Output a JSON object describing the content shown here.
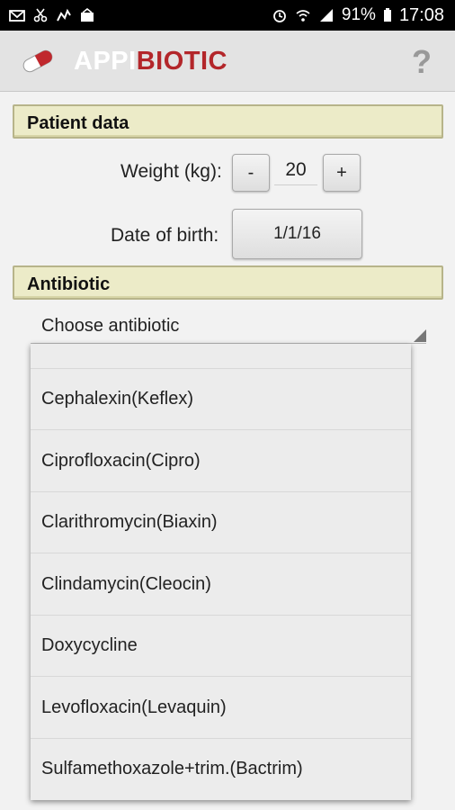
{
  "status_bar": {
    "left_icons": [
      "email-icon",
      "scissors-icon",
      "run-icon",
      "inbox-icon"
    ],
    "alarm_icon": "alarm-icon",
    "wifi_icon": "wifi-icon",
    "signal_icon": "signal-icon",
    "battery_percent": "91%",
    "battery_icon": "battery-icon",
    "time": "17:08"
  },
  "app_bar": {
    "logo_icon": "pill-icon",
    "title_part1": "APPI",
    "title_part2": "BIOTIC",
    "title_colors": {
      "part1": "#ffffff",
      "part2": "#b3262a"
    },
    "help_label": "?"
  },
  "patient_section": {
    "header": "Patient data",
    "weight_label": "Weight (kg):",
    "decrement_label": "-",
    "weight_value": "20",
    "increment_label": "+",
    "dob_label": "Date of birth:",
    "dob_value": "1/1/16"
  },
  "antibiotic_section": {
    "header": "Antibiotic",
    "spinner_selected": "Choose antibiotic",
    "options": [
      "",
      "Cephalexin(Keflex)",
      "Ciprofloxacin(Cipro)",
      "Clarithromycin(Biaxin)",
      "Clindamycin(Cleocin)",
      "Doxycycline",
      "Levofloxacin(Levaquin)",
      "Sulfamethoxazole+trim.(Bactrim)"
    ]
  },
  "colors": {
    "section_bg": "#ecebc8",
    "section_border": "#b7b48a",
    "brand_red": "#b3262a"
  }
}
